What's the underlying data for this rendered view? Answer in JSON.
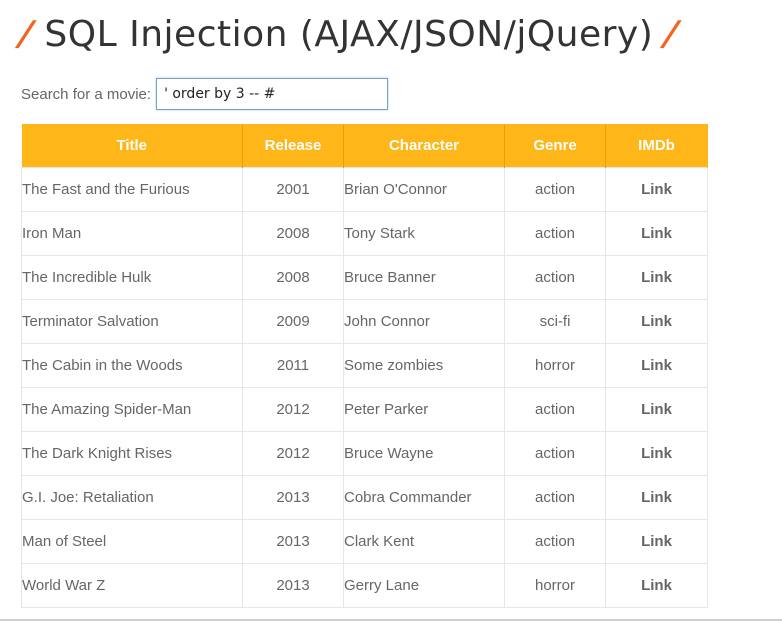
{
  "header": {
    "slash": "/",
    "title": "SQL Injection (AJAX/JSON/jQuery)",
    "accent_color": "#f26522"
  },
  "search": {
    "label": "Search for a movie:",
    "value": "' order by 3 -- #"
  },
  "table": {
    "header_color": "#ffb619",
    "columns": [
      "Title",
      "Release",
      "Character",
      "Genre",
      "IMDb"
    ],
    "rows": [
      {
        "title": "The Fast and the Furious",
        "release": "2001",
        "character": "Brian O'Connor",
        "genre": "action",
        "imdb": "Link"
      },
      {
        "title": "Iron Man",
        "release": "2008",
        "character": "Tony Stark",
        "genre": "action",
        "imdb": "Link"
      },
      {
        "title": "The Incredible Hulk",
        "release": "2008",
        "character": "Bruce Banner",
        "genre": "action",
        "imdb": "Link"
      },
      {
        "title": "Terminator Salvation",
        "release": "2009",
        "character": "John Connor",
        "genre": "sci-fi",
        "imdb": "Link"
      },
      {
        "title": "The Cabin in the Woods",
        "release": "2011",
        "character": "Some zombies",
        "genre": "horror",
        "imdb": "Link"
      },
      {
        "title": "The Amazing Spider-Man",
        "release": "2012",
        "character": "Peter Parker",
        "genre": "action",
        "imdb": "Link"
      },
      {
        "title": "The Dark Knight Rises",
        "release": "2012",
        "character": "Bruce Wayne",
        "genre": "action",
        "imdb": "Link"
      },
      {
        "title": "G.I. Joe: Retaliation",
        "release": "2013",
        "character": "Cobra Commander",
        "genre": "action",
        "imdb": "Link"
      },
      {
        "title": "Man of Steel",
        "release": "2013",
        "character": "Clark Kent",
        "genre": "action",
        "imdb": "Link"
      },
      {
        "title": "World War Z",
        "release": "2013",
        "character": "Gerry Lane",
        "genre": "horror",
        "imdb": "Link"
      }
    ]
  }
}
